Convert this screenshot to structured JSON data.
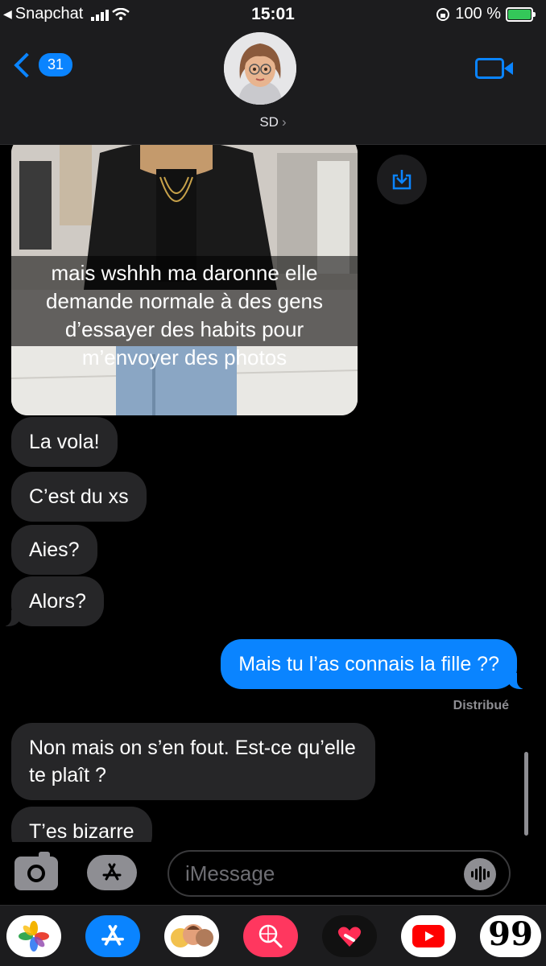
{
  "status_bar": {
    "back_app": "Snapchat",
    "time": "15:01",
    "battery": "100 %"
  },
  "header": {
    "back_badge": "31",
    "contact_name": "SD",
    "chevron": "›"
  },
  "photo_message": {
    "caption": "mais wshhh ma daronne elle demande normale à des gens d’essayer des habits pour m’envoyer des photos"
  },
  "messages": [
    {
      "direction": "incoming",
      "text": "La vola!"
    },
    {
      "direction": "incoming",
      "text": "C’est du xs"
    },
    {
      "direction": "incoming",
      "text": "Aies?"
    },
    {
      "direction": "incoming",
      "text": "Alors?"
    },
    {
      "direction": "outgoing",
      "text": "Mais tu l’as connais la fille ??"
    },
    {
      "direction": "incoming",
      "text": "Non mais on s’en fout. Est-ce qu’elle te plaît ?"
    },
    {
      "direction": "incoming",
      "text": "T’es bizarre"
    }
  ],
  "delivered_label": "Distribué",
  "composer": {
    "placeholder": "iMessage"
  },
  "app_drawer": {
    "apps": [
      "photos-icon",
      "app-store-icon",
      "memoji-stickers-icon",
      "web-search-icon",
      "digital-touch-icon",
      "youtube-icon",
      "quote-icon"
    ],
    "quote_glyph": "99"
  },
  "colors": {
    "accent": "#0a84ff",
    "incoming_bubble": "#262628",
    "background": "#000000",
    "battery": "#34c759"
  }
}
